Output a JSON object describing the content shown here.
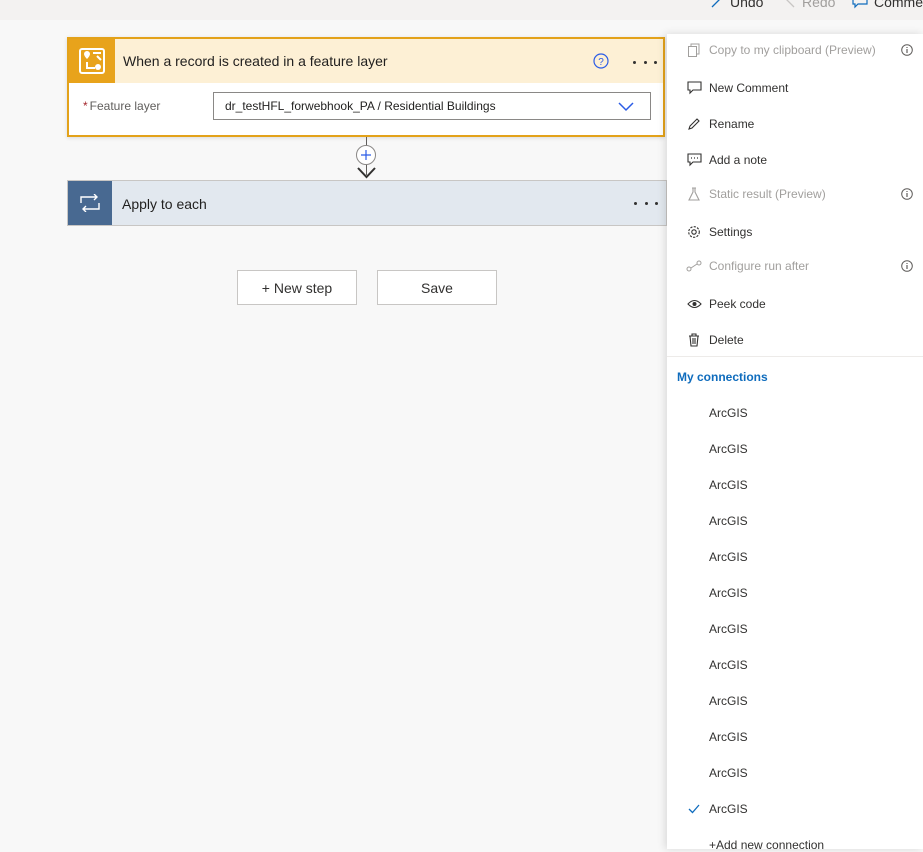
{
  "topbar": {
    "undo": "Undo",
    "redo": "Redo",
    "comments": "Comme"
  },
  "trigger": {
    "title": "When a record is created in a feature layer",
    "field_label": "Feature layer",
    "field_value": "dr_testHFL_forwebhook_PA / Residential Buildings"
  },
  "apply": {
    "title": "Apply to each"
  },
  "buttons": {
    "new_step": "+ New step",
    "save": "Save"
  },
  "menu": {
    "items": [
      {
        "label": "Copy to my clipboard (Preview)",
        "icon": "copy-icon",
        "disabled": true,
        "info": true
      },
      {
        "label": "New Comment",
        "icon": "comment-icon",
        "disabled": false,
        "info": false
      },
      {
        "label": "Rename",
        "icon": "pencil-icon",
        "disabled": false,
        "info": false
      },
      {
        "label": "Add a note",
        "icon": "note-icon",
        "disabled": false,
        "info": false
      },
      {
        "label": "Static result (Preview)",
        "icon": "flask-icon",
        "disabled": true,
        "info": true
      },
      {
        "label": "Settings",
        "icon": "gear-icon",
        "disabled": false,
        "info": false
      },
      {
        "label": "Configure run after",
        "icon": "run-after-icon",
        "disabled": true,
        "info": true
      },
      {
        "label": "Peek code",
        "icon": "eye-icon",
        "disabled": false,
        "info": false
      },
      {
        "label": "Delete",
        "icon": "trash-icon",
        "disabled": false,
        "info": false
      }
    ],
    "connections_heading": "My connections",
    "connections": [
      "ArcGIS",
      "ArcGIS",
      "ArcGIS",
      "ArcGIS",
      "ArcGIS",
      "ArcGIS",
      "ArcGIS",
      "ArcGIS",
      "ArcGIS",
      "ArcGIS",
      "ArcGIS",
      "ArcGIS"
    ],
    "selected_connection_index": 11,
    "add_connection": "+Add new connection"
  },
  "colors": {
    "trigger_accent": "#e8a31b",
    "trigger_header_bg": "#fdf0d5",
    "apply_accent": "#486991",
    "link_blue": "#0f6cbd"
  }
}
